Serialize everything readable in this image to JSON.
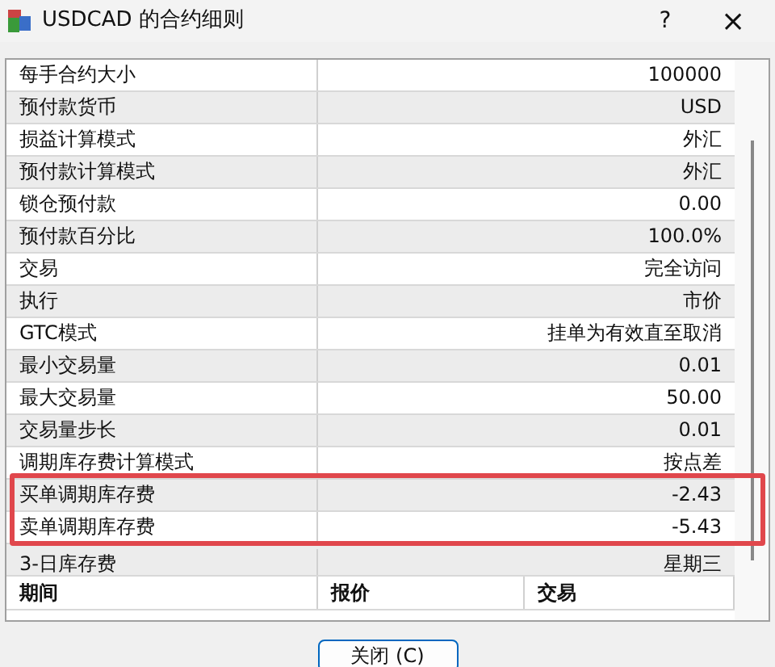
{
  "window": {
    "title": "USDCAD 的合约细则",
    "help": "?",
    "close": "×"
  },
  "rows": [
    {
      "label": "每手合约大小",
      "value": "100000"
    },
    {
      "label": "预付款货币",
      "value": "USD"
    },
    {
      "label": "损益计算模式",
      "value": "外汇"
    },
    {
      "label": "预付款计算模式",
      "value": "外汇"
    },
    {
      "label": "锁仓预付款",
      "value": "0.00"
    },
    {
      "label": "预付款百分比",
      "value": "100.0%"
    },
    {
      "label": "交易",
      "value": "完全访问"
    },
    {
      "label": "执行",
      "value": "市价"
    },
    {
      "label": "GTC模式",
      "value": "挂单为有效直至取消"
    },
    {
      "label": "最小交易量",
      "value": "0.01"
    },
    {
      "label": "最大交易量",
      "value": "50.00"
    },
    {
      "label": "交易量步长",
      "value": "0.01"
    },
    {
      "label": "调期库存费计算模式",
      "value": "按点差"
    },
    {
      "label": "买单调期库存费",
      "value": "-2.43"
    },
    {
      "label": "卖单调期库存费",
      "value": "-5.43"
    },
    {
      "label": "3-日库存费",
      "value": "星期三"
    }
  ],
  "sessions_header": [
    "期间",
    "报价",
    "交易"
  ],
  "highlight": {
    "color": "#e0474c"
  },
  "buttons": [
    "关闭 (C)"
  ]
}
